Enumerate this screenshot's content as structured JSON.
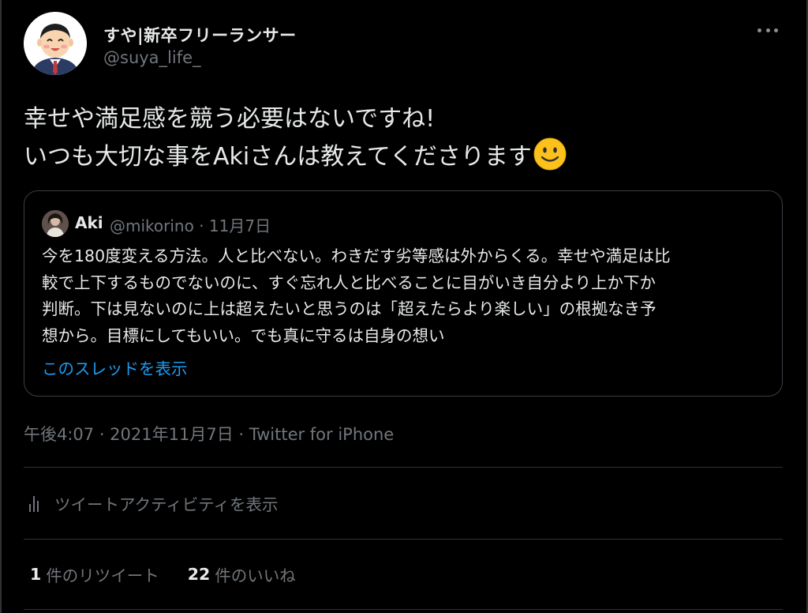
{
  "author": {
    "display_name": "すや|新卒フリーランサー",
    "handle": "@suya_life_"
  },
  "tweet": {
    "lines": [
      "幸せや満足感を競う必要はないですね!",
      "いつも大切な事をAkiさんは教えてくださります"
    ],
    "emoji": "slightly-smiling-face"
  },
  "quote": {
    "name": "Aki",
    "meta": "@mikorino · 11月7日",
    "lines": [
      "今を180度変える方法。人と比べない。わきだす劣等感は外からくる。幸せや満足は比",
      "較で上下するものでないのに、すぐ忘れ人と比べることに目がいき自分より上か下か",
      "判断。下は見ないのに上は超えたいと思うのは「超えたらより楽しい」の根拠なき予",
      "想から。目標にしてもいい。でも真に守るは自身の想い"
    ],
    "show_thread": "このスレッドを表示"
  },
  "timestamp": "午後4:07 · 2021年11月7日 · Twitter for iPhone",
  "activity_label": "ツイートアクティビティを表示",
  "stats": {
    "retweets_count": "1",
    "retweets_label": "件のリツイート",
    "likes_count": "22",
    "likes_label": "件のいいね"
  },
  "colors": {
    "background": "#000000",
    "text": "#e7e9ea",
    "secondary": "#71767b",
    "link": "#1d9bf0",
    "border": "#2f3336"
  }
}
